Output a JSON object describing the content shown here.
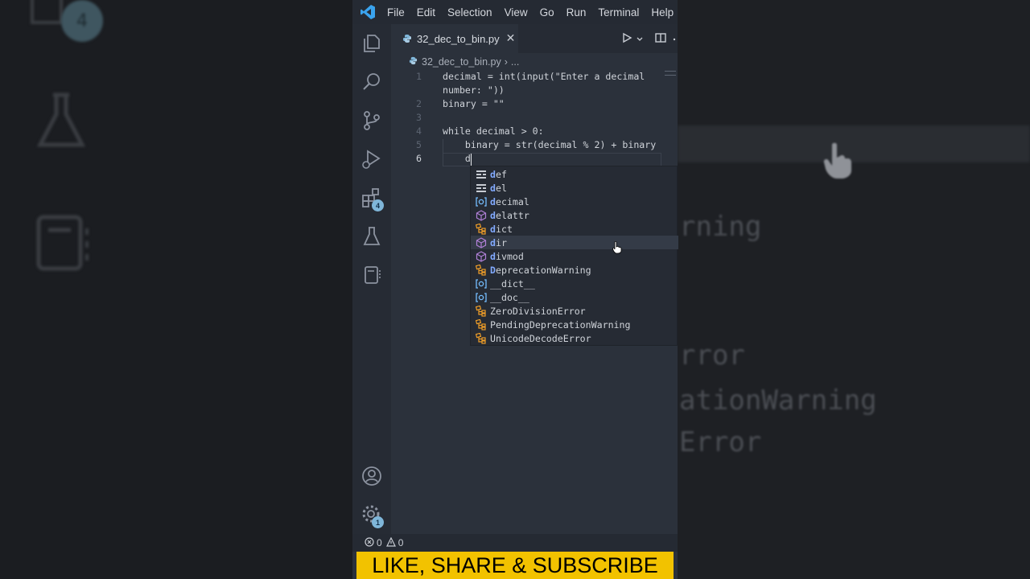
{
  "menu": [
    "File",
    "Edit",
    "Selection",
    "View",
    "Go",
    "Run",
    "Terminal",
    "Help"
  ],
  "tab": {
    "filename": "32_dec_to_bin.py",
    "close": "✕"
  },
  "breadcrumb": {
    "file": "32_dec_to_bin.py",
    "sep": "›",
    "more": "..."
  },
  "activity_badges": {
    "extensions": "4",
    "settings": "1"
  },
  "code_lines": [
    {
      "num": "1",
      "text_a": "decimal = int(input(\"Enter a decimal",
      "text_b": "number: \"))"
    },
    {
      "num": "2",
      "text": "binary = \"\""
    },
    {
      "num": "3",
      "text": ""
    },
    {
      "num": "4",
      "text": "while decimal > 0:"
    },
    {
      "num": "5",
      "text": "    binary = str(decimal % 2) + binary"
    },
    {
      "num": "6",
      "text": "    d"
    }
  ],
  "suggestions": [
    {
      "match": "d",
      "rest": "ef",
      "kind": "keyword"
    },
    {
      "match": "d",
      "rest": "el",
      "kind": "keyword"
    },
    {
      "match": "d",
      "rest": "ecimal",
      "kind": "variable"
    },
    {
      "match": "d",
      "rest": "elattr",
      "kind": "function"
    },
    {
      "match": "d",
      "rest": "ict",
      "kind": "class"
    },
    {
      "match": "d",
      "rest": "ir",
      "kind": "function"
    },
    {
      "match": "d",
      "rest": "ivmod",
      "kind": "function"
    },
    {
      "match": "D",
      "rest": "eprecationWarning",
      "kind": "class"
    },
    {
      "match": "",
      "rest": "__dict__",
      "kind": "variable"
    },
    {
      "match": "",
      "rest": "__doc__",
      "kind": "variable"
    },
    {
      "match": "",
      "rest": "ZeroDivisionError",
      "kind": "class"
    },
    {
      "match": "",
      "rest": "PendingDeprecationWarning",
      "kind": "class"
    },
    {
      "match": "",
      "rest": "UnicodeDecodeError",
      "kind": "class"
    }
  ],
  "status": {
    "errors": "0",
    "warnings": "0"
  },
  "banner": "LIKE, SHARE & SUBSCRIBE",
  "bg_right": [
    "rning",
    "rror",
    "ationWarning",
    "Error"
  ],
  "bg_left_badge": "4",
  "colors": {
    "accent": "#82aaff",
    "banner": "#f2c200",
    "badge": "#7fb6d9"
  }
}
